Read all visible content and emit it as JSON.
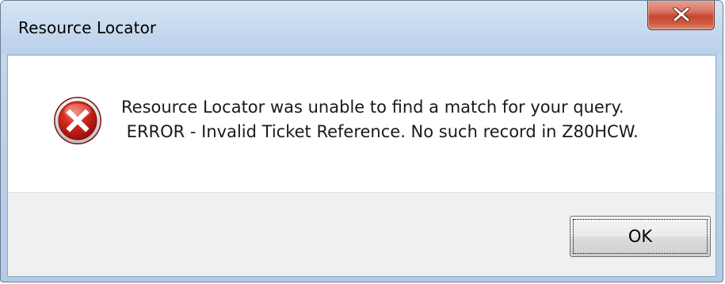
{
  "window": {
    "title": "Resource Locator",
    "close_icon": "close-x-icon"
  },
  "message": {
    "icon": "error-icon",
    "line1": "Resource Locator was unable to find a match for your query.",
    "line2": " ERROR - Invalid Ticket Reference. No such record in Z80HCW."
  },
  "buttons": {
    "ok_label": "OK"
  },
  "colors": {
    "close_button": "#c4462f",
    "error_icon": "#c8211b",
    "titlebar": "#c5d9ef",
    "button_area": "#f0f0f0"
  }
}
